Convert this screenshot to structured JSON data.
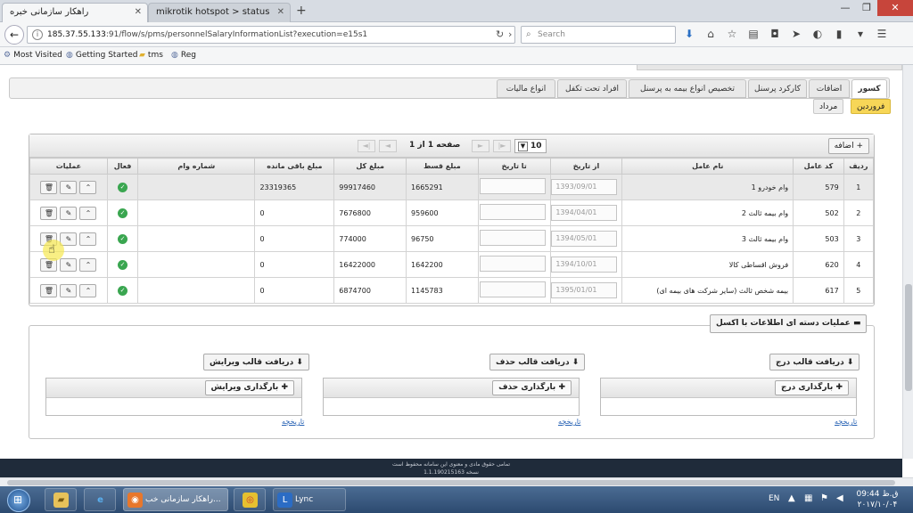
{
  "browser": {
    "tabs": [
      {
        "title": "راهکار سازمانی خبره",
        "active": true
      },
      {
        "title": "mikrotik hotspot > status",
        "active": false
      }
    ],
    "url_host": "185.37.55.133",
    "url_rest": ":91/flow/s/pms/personnelSalaryInformationList?execution=e15s1",
    "search_placeholder": "Search",
    "bookmarks": [
      "Most Visited",
      "Getting Started",
      "tms",
      "Reg"
    ]
  },
  "page": {
    "main_tabs": [
      "کسور",
      "اضافات",
      "کارکرد پرسنل",
      "تخصیص انواع بیمه به پرسنل",
      "افراد تحت تکفل",
      "انواع مالیات"
    ],
    "sub_tabs": [
      "فروردین",
      "مرداد"
    ],
    "grid": {
      "add_label": "اضافه",
      "pager_text": "صفحه 1 از 1",
      "page_size": "10",
      "columns": [
        "ردیف",
        "کد عامل",
        "نام عامل",
        "از تاریخ",
        "تا تاریخ",
        "مبلغ قسط",
        "مبلغ کل",
        "مبلغ باقی مانده",
        "شماره وام",
        "فعال",
        "عملیات"
      ],
      "rows": [
        {
          "row": "1",
          "code": "579",
          "name": "وام خودرو 1",
          "from": "1393/09/01",
          "installment": "1665291",
          "total": "99917460",
          "remaining": "23319365"
        },
        {
          "row": "2",
          "code": "502",
          "name": "وام بیمه ثالث 2",
          "from": "1394/04/01",
          "installment": "959600",
          "total": "7676800",
          "remaining": "0"
        },
        {
          "row": "3",
          "code": "503",
          "name": "وام بیمه ثالث 3",
          "from": "1394/05/01",
          "installment": "96750",
          "total": "774000",
          "remaining": "0"
        },
        {
          "row": "4",
          "code": "620",
          "name": "فروش اقساطی کالا",
          "from": "1394/10/01",
          "installment": "1642200",
          "total": "16422000",
          "remaining": "0"
        },
        {
          "row": "5",
          "code": "617",
          "name": "بیمه شخص ثالث (سایر شرکت های بیمه ای)",
          "from": "1395/01/01",
          "installment": "1145783",
          "total": "6874700",
          "remaining": "0"
        }
      ]
    },
    "bulk": {
      "header": "عملیات دسته ای اطلاعات با اکسل",
      "download_buttons": [
        "دریافت قالب درج",
        "دریافت قالب حذف",
        "دریافت قالب ویرایش"
      ],
      "upload_buttons": [
        "بارگذاری درج",
        "بارگذاری حذف",
        "بارگذاری ویرایش"
      ],
      "history_link": "تاریخچه"
    },
    "footer_line1": "تمامی حقوق مادی و معنوی این سامانه محفوظ است",
    "footer_line2": "نسخه 1.1.190215163"
  },
  "taskbar": {
    "items": [
      "راهکار سازمانی خب...",
      "Lync"
    ],
    "lang": "EN",
    "time": "09:44 ق.ظ",
    "date": "۲۰۱۷/۱۰/۰۴"
  },
  "colors": {
    "selected_subtab": "#f7d657",
    "active_check": "#3aa650",
    "footer_bg": "#1f2b3a"
  }
}
